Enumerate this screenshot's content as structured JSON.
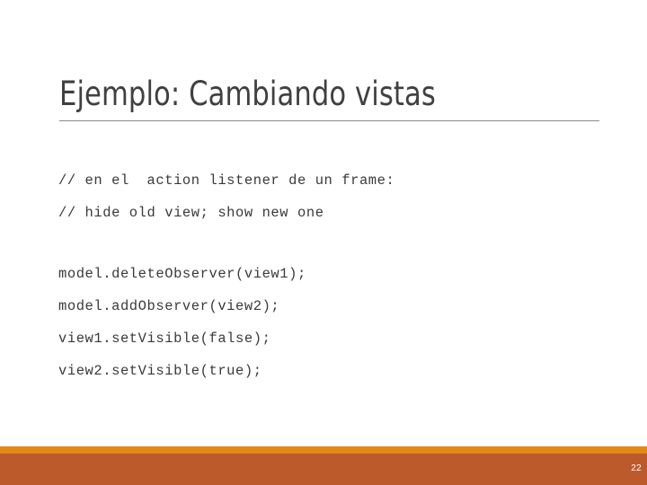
{
  "slide": {
    "title": "Ejemplo: Cambiando vistas",
    "page_number": "22",
    "colors": {
      "background": "#ffffff",
      "title_text": "#404040",
      "title_rule": "#8c8c8c",
      "code_text": "#3a3a3a",
      "footer_accent": "#E18A18",
      "footer_band": "#BC5A2C",
      "page_number_text": "#ffffff"
    },
    "code_lines": [
      {
        "id": "comment-1",
        "text": "// en el  action listener de un frame:"
      },
      {
        "id": "comment-2",
        "text": "// hide old view; show new one"
      },
      {
        "id": "blank-1",
        "text": ""
      },
      {
        "id": "stmt-1",
        "text": "model.deleteObserver(view1);"
      },
      {
        "id": "stmt-2",
        "text": "model.addObserver(view2);"
      },
      {
        "id": "stmt-3",
        "text": "view1.setVisible(false);"
      },
      {
        "id": "stmt-4",
        "text": "view2.setVisible(true);"
      }
    ]
  }
}
